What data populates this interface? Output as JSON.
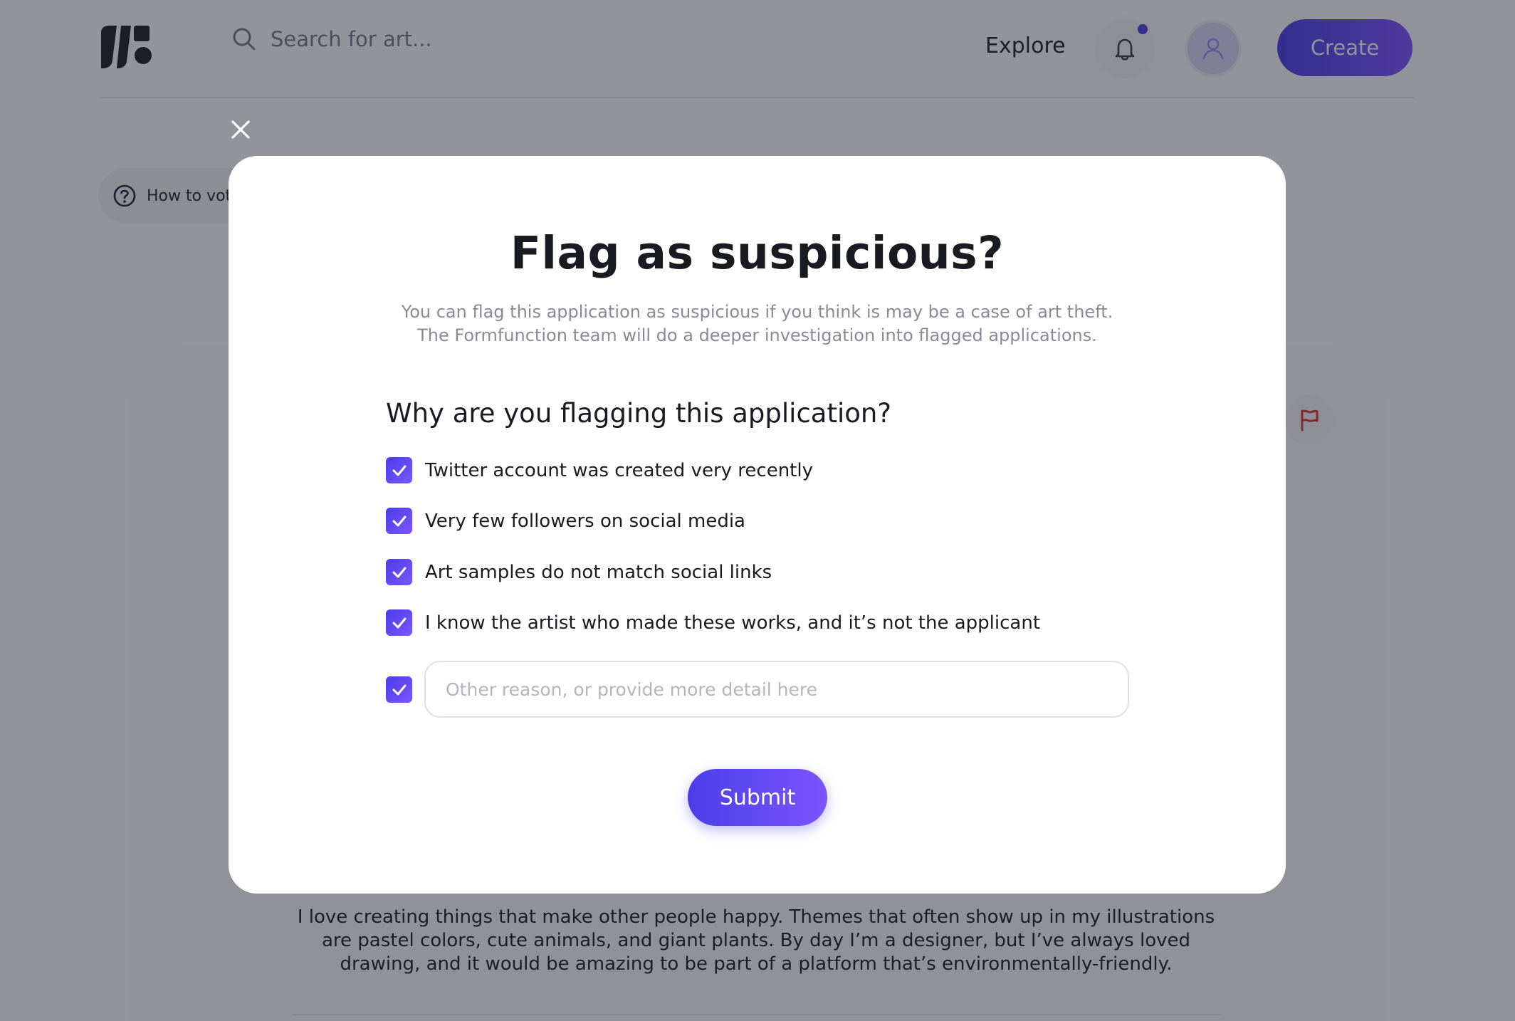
{
  "header": {
    "logo_icon": "formfunction-logo-icon",
    "search": {
      "placeholder": "Search for art...",
      "value": ""
    },
    "nav_explore": "Explore",
    "notification_icon": "bell-icon",
    "avatar_icon": "user-icon",
    "create_label": "Create"
  },
  "background": {
    "how_to_vote_label": "How to vote",
    "flag_icon": "flag-icon",
    "bio_text": "I love creating things that make other people happy. Themes that often show up in my illustrations are pastel colors, cute animals, and giant plants. By day I’m a designer, but I’ve always loved drawing, and it would be amazing to be part of a platform that’s environmentally-friendly."
  },
  "modal": {
    "close_icon": "close-icon",
    "title": "Flag as suspicious?",
    "description": "You can flag this application as suspicious if you think is may be a case of art theft. The Formfunction team will do a deeper investigation into flagged applications.",
    "question": "Why are you flagging this application?",
    "options": [
      {
        "label": "Twitter account was created very recently",
        "checked": true
      },
      {
        "label": "Very few followers on social media",
        "checked": true
      },
      {
        "label": "Art samples do not match social links",
        "checked": true
      },
      {
        "label": "I know the artist who made these works, and it’s not the applicant",
        "checked": true
      }
    ],
    "other": {
      "checked": true,
      "placeholder": "Other reason, or provide more detail here",
      "value": ""
    },
    "submit_label": "Submit"
  },
  "colors": {
    "accent": "#4a3ee8",
    "accent_light": "#7b55ff",
    "overlay": "rgba(30,30,46,0.48)",
    "text_primary": "#1a1a22",
    "text_muted": "#8a8a94"
  }
}
